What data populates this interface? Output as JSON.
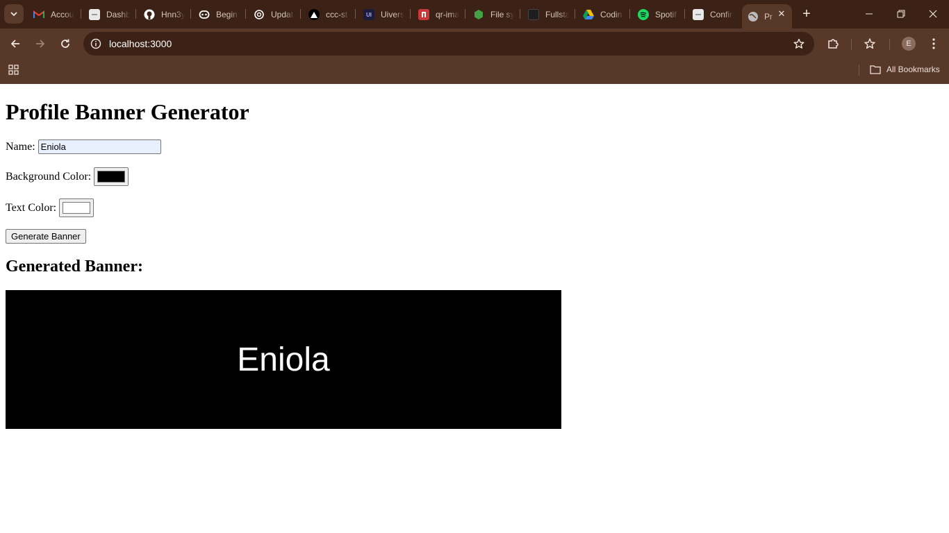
{
  "browser": {
    "tabs": [
      {
        "label": "Accou",
        "icon": "gmail-icon",
        "color": "#ea4335"
      },
      {
        "label": "Dashb",
        "icon": "page-icon",
        "color": "#e8e8e8"
      },
      {
        "label": "Hnn3y",
        "icon": "github-icon",
        "color": "#ffffff"
      },
      {
        "label": "Begin",
        "icon": "copilot-icon",
        "color": "#ffffff"
      },
      {
        "label": "Updat",
        "icon": "openai-icon",
        "color": "#ffffff"
      },
      {
        "label": "ccc-st",
        "icon": "vercel-icon",
        "color": "#000000"
      },
      {
        "label": "Uivers",
        "icon": "uiverse-icon",
        "color": "#1b1b3a"
      },
      {
        "label": "qr-ima",
        "icon": "npm-icon",
        "color": "#cb3837"
      },
      {
        "label": "File sy",
        "icon": "nodejs-icon",
        "color": "#43a047"
      },
      {
        "label": "Fullsta",
        "icon": "dark-square-icon",
        "color": "#1e1e1e"
      },
      {
        "label": "Codin",
        "icon": "drive-icon",
        "color": "#34a853"
      },
      {
        "label": "Spotif",
        "icon": "spotify-icon",
        "color": "#1ed760"
      },
      {
        "label": "Confir",
        "icon": "page-icon",
        "color": "#e8e8e8"
      },
      {
        "label": "Pr",
        "icon": "globe-icon",
        "color": "#bbbbbb"
      }
    ],
    "url": "localhost:3000",
    "profile_initial": "E",
    "all_bookmarks": "All Bookmarks"
  },
  "page": {
    "title": "Profile Banner Generator",
    "name_label": "Name:",
    "name_value": "Eniola",
    "bg_label": "Background Color:",
    "bg_color": "#000000",
    "text_label": "Text Color:",
    "text_color": "#ffffff",
    "button_label": "Generate Banner",
    "subtitle": "Generated Banner:",
    "banner_text": "Eniola"
  }
}
